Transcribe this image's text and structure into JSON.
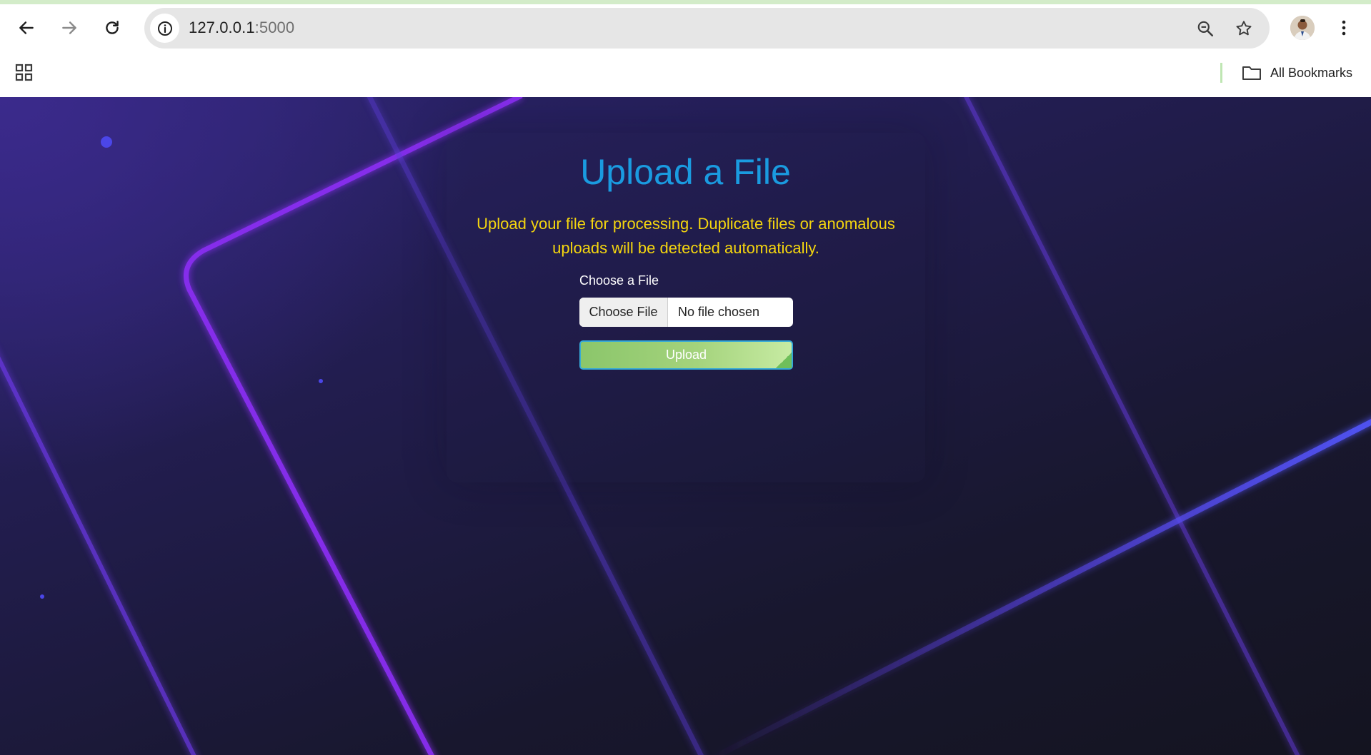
{
  "browser": {
    "url_host": "127.0.0.1",
    "url_port": ":5000",
    "bookmarks_label": "All Bookmarks",
    "icons": [
      "back-arrow-icon",
      "forward-arrow-icon",
      "reload-icon",
      "info-icon",
      "zoom-icon",
      "star-icon",
      "profile-avatar",
      "more-menu-icon",
      "apps-grid-icon",
      "folder-icon"
    ]
  },
  "page": {
    "title": "Upload a File",
    "subtitle": "Upload your file for processing. Duplicate files or anomalous uploads will be detected automatically.",
    "file_label": "Choose a File",
    "choose_button": "Choose File",
    "file_status": "No file chosen",
    "upload_button": "Upload"
  },
  "colors": {
    "title": "#1a9be0",
    "subtitle": "#f5d60e",
    "background_dark": "#141420",
    "background_purple": "#2c2470",
    "neon_line": "#7b2ff0",
    "upload_green": "#8bc66b"
  }
}
